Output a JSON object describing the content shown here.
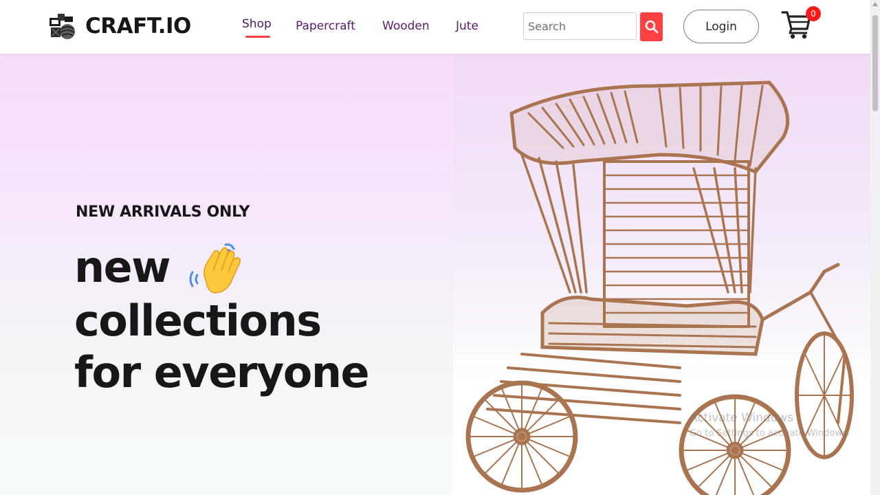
{
  "brand": {
    "name": "CRAFT.IO",
    "logo_icon": "craft-logo-icon"
  },
  "nav": {
    "links": [
      {
        "label": "Shop",
        "active": true
      },
      {
        "label": "Papercraft",
        "active": false
      },
      {
        "label": "Wooden",
        "active": false
      },
      {
        "label": "Jute",
        "active": false
      }
    ]
  },
  "search": {
    "placeholder": "Search",
    "value": "",
    "button_icon": "search-icon"
  },
  "login": {
    "label": "Login"
  },
  "cart": {
    "icon": "cart-icon",
    "count": "0"
  },
  "hero": {
    "kicker": "NEW ARRIVALS ONLY",
    "headline": [
      "new",
      "collections",
      "for everyone"
    ],
    "hand_icon": "waving-hand-icon",
    "image": "wooden-rickshaw-image"
  },
  "watermark": {
    "line1": "Activate Windows",
    "line2": "Go to Settings to activate Windows."
  },
  "colors": {
    "accent": "#ff4141",
    "nav_text": "#5a1a6b",
    "hero_top": "#f8dcfa",
    "wood": "#a9744f",
    "text": "#171717"
  }
}
